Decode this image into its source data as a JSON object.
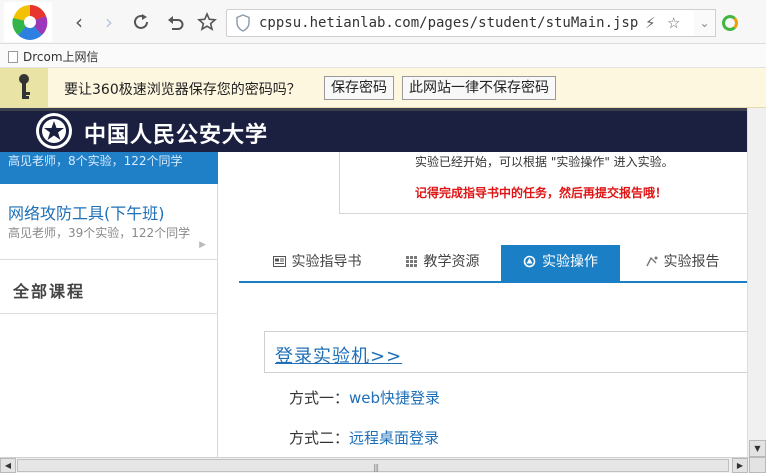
{
  "browser": {
    "url": "cppsu.hetianlab.com/pages/student/stuMain.jsp",
    "bookmark": "Drcom上网信"
  },
  "password_bar": {
    "message": "要让360极速浏览器保存您的密码吗？",
    "save_label": "保存密码",
    "never_label": "此网站一律不保存密码"
  },
  "header": {
    "university": "中国人民公安大学"
  },
  "sidebar": {
    "active_course_sub": "高见老师，8个实验，122个同学",
    "course2_name": "网络攻防工具(下午班)",
    "course2_sub": "高见老师，39个实验，122个同学",
    "all_courses": "全部课程"
  },
  "notice": {
    "line1": "实验已经开始，可以根据 \"实验操作\" 进入实验。",
    "line2": "记得完成指导书中的任务，然后再提交报告哦！"
  },
  "tabs": [
    {
      "label": "实验指导书",
      "icon": "book-icon"
    },
    {
      "label": "教学资源",
      "icon": "grid-icon"
    },
    {
      "label": "实验操作",
      "icon": "operate-icon",
      "active": true
    },
    {
      "label": "实验报告",
      "icon": "report-icon"
    }
  ],
  "login": {
    "link": "登录实验机>>",
    "method1_label": "方式一：",
    "method1_link": "web快捷登录",
    "method2_label": "方式二：",
    "method2_link": "远程桌面登录"
  },
  "colors": {
    "accent": "#1a7fc4",
    "banner": "#1b2040",
    "warning_text": "#e01515"
  }
}
